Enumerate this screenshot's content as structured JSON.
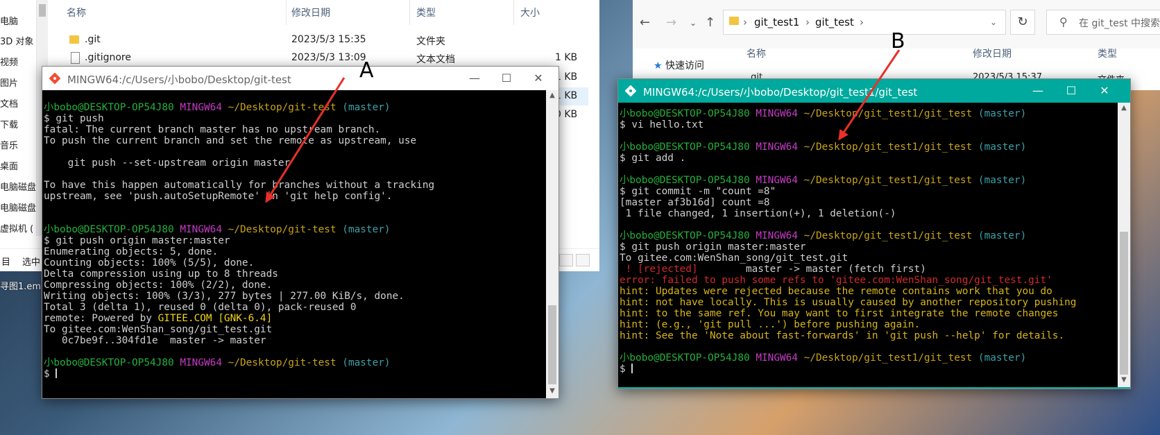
{
  "left_explorer": {
    "nav_items": [
      "电脑",
      "3D 对象",
      "视频",
      "图片",
      "文档",
      "下载",
      "音乐",
      "桌面",
      "电脑磁盘",
      "电脑磁盘",
      "虚拟机 ("
    ],
    "columns": {
      "name": "名称",
      "date": "修改日期",
      "type": "类型",
      "size": "大小"
    },
    "files": [
      {
        "name": ".git",
        "date": "2023/5/3 15:35",
        "type": "文件夹",
        "size": "",
        "icon": "folder-icon"
      },
      {
        "name": ".gitignore",
        "date": "2023/5/3 13:09",
        "type": "文本文档",
        "size": "1 KB",
        "icon": "document-icon"
      },
      {
        "name": "",
        "date": "",
        "type": "",
        "size": "1 KB",
        "icon": ""
      },
      {
        "name": "",
        "date": "",
        "type": "",
        "size": "1 KB",
        "icon": ""
      },
      {
        "name": "",
        "date": "",
        "type": "",
        "size": "0 KB",
        "icon": ""
      }
    ],
    "status_left": "目",
    "status_select": "选中",
    "truncated_file": "寻图1.em"
  },
  "right_explorer": {
    "breadcrumb": [
      "git_test1",
      "git_test"
    ],
    "search_placeholder": "在 git_test 中搜索",
    "quick_access": "快速访问",
    "columns": {
      "name": "名称",
      "date": "修改日期",
      "type": "类型"
    },
    "partial_row": {
      "name": ".git",
      "date": "2023/5/3 15:37",
      "type": "文件夹"
    }
  },
  "terminal_a": {
    "title": "MINGW64:/c/Users/小bobo/Desktop/git-test",
    "lines": [
      [
        [
          "小bobo@DESKTOP-OP54J80 ",
          "green"
        ],
        [
          "MINGW64 ",
          "purple"
        ],
        [
          "~/Desktop/git-test ",
          "yellow"
        ],
        [
          "(master)",
          "cyan"
        ]
      ],
      [
        [
          "$ git push",
          "white"
        ]
      ],
      [
        [
          "fatal: The current branch master has no upstream branch.",
          "white"
        ]
      ],
      [
        [
          "To push the current branch and set the remote as upstream, use",
          "white"
        ]
      ],
      [
        [
          "",
          "white"
        ]
      ],
      [
        [
          "    git push --set-upstream origin master",
          "white"
        ]
      ],
      [
        [
          "",
          "white"
        ]
      ],
      [
        [
          "To have this happen automatically for branches without a tracking",
          "white"
        ]
      ],
      [
        [
          "upstream, see 'push.autoSetupRemote' in 'git help config'.",
          "white"
        ]
      ],
      [
        [
          "",
          "white"
        ]
      ],
      [
        [
          "",
          "white"
        ]
      ],
      [
        [
          "小bobo@DESKTOP-OP54J80 ",
          "green"
        ],
        [
          "MINGW64 ",
          "purple"
        ],
        [
          "~/Desktop/git-test ",
          "yellow"
        ],
        [
          "(master)",
          "cyan"
        ]
      ],
      [
        [
          "$ git push origin master:master",
          "white"
        ]
      ],
      [
        [
          "Enumerating objects: 5, done.",
          "white"
        ]
      ],
      [
        [
          "Counting objects: 100% (5/5), done.",
          "white"
        ]
      ],
      [
        [
          "Delta compression using up to 8 threads",
          "white"
        ]
      ],
      [
        [
          "Compressing objects: 100% (2/2), done.",
          "white"
        ]
      ],
      [
        [
          "Writing objects: 100% (3/3), 277 bytes | 277.00 KiB/s, done.",
          "white"
        ]
      ],
      [
        [
          "Total 3 (delta 1), reused 0 (delta 0), pack-reused 0",
          "white"
        ]
      ],
      [
        [
          "remote: Powered by ",
          "white"
        ],
        [
          "GITEE.COM ",
          "gitee"
        ],
        [
          "[GNK-6.4]",
          "gitee"
        ]
      ],
      [
        [
          "To gitee.com:WenShan_song/git_test.git",
          "white"
        ]
      ],
      [
        [
          "   0c7be9f..304fd1e  master -> master",
          "white"
        ]
      ],
      [
        [
          "",
          "white"
        ]
      ],
      [
        [
          "小bobo@DESKTOP-OP54J80 ",
          "green"
        ],
        [
          "MINGW64 ",
          "purple"
        ],
        [
          "~/Desktop/git-test ",
          "yellow"
        ],
        [
          "(master)",
          "cyan"
        ]
      ],
      [
        [
          "$ ",
          "white"
        ]
      ]
    ]
  },
  "terminal_b": {
    "title": "MINGW64:/c/Users/小bobo/Desktop/git_test1/git_test",
    "lines": [
      [
        [
          "小bobo@DESKTOP-OP54J80 ",
          "green"
        ],
        [
          "MINGW64 ",
          "purple"
        ],
        [
          "~/Desktop/git_test1/git_test ",
          "yellow"
        ],
        [
          "(master)",
          "cyan"
        ]
      ],
      [
        [
          "$ vi hello.txt",
          "white"
        ]
      ],
      [
        [
          "",
          "white"
        ]
      ],
      [
        [
          "小bobo@DESKTOP-OP54J80 ",
          "green"
        ],
        [
          "MINGW64 ",
          "purple"
        ],
        [
          "~/Desktop/git_test1/git_test ",
          "yellow"
        ],
        [
          "(master)",
          "cyan"
        ]
      ],
      [
        [
          "$ git add .",
          "white"
        ]
      ],
      [
        [
          "",
          "white"
        ]
      ],
      [
        [
          "小bobo@DESKTOP-OP54J80 ",
          "green"
        ],
        [
          "MINGW64 ",
          "purple"
        ],
        [
          "~/Desktop/git_test1/git_test ",
          "yellow"
        ],
        [
          "(master)",
          "cyan"
        ]
      ],
      [
        [
          "$ git commit -m \"count =8\"",
          "white"
        ]
      ],
      [
        [
          "[master af3b16d] count =8",
          "white"
        ]
      ],
      [
        [
          " 1 file changed, 1 insertion(+), 1 deletion(-)",
          "white"
        ]
      ],
      [
        [
          "",
          "white"
        ]
      ],
      [
        [
          "小bobo@DESKTOP-OP54J80 ",
          "green"
        ],
        [
          "MINGW64 ",
          "purple"
        ],
        [
          "~/Desktop/git_test1/git_test ",
          "yellow"
        ],
        [
          "(master)",
          "cyan"
        ]
      ],
      [
        [
          "$ git push origin master:master",
          "white"
        ]
      ],
      [
        [
          "To gitee.com:WenShan_song/git_test.git",
          "white"
        ]
      ],
      [
        [
          " ! [rejected]        ",
          "red"
        ],
        [
          "master -> master (fetch first)",
          "white"
        ]
      ],
      [
        [
          "error: failed to push some refs to 'gitee.com:WenShan_song/git_test.git'",
          "red"
        ]
      ],
      [
        [
          "hint: Updates were rejected because the remote contains work that you do",
          "hint"
        ]
      ],
      [
        [
          "hint: not have locally. This is usually caused by another repository pushing",
          "hint"
        ]
      ],
      [
        [
          "hint: to the same ref. You may want to first integrate the remote changes",
          "hint"
        ]
      ],
      [
        [
          "hint: (e.g., 'git pull ...') before pushing again.",
          "hint"
        ]
      ],
      [
        [
          "hint: See the 'Note about fast-forwards' in 'git push --help' for details.",
          "hint"
        ]
      ],
      [
        [
          "",
          "white"
        ]
      ],
      [
        [
          "小bobo@DESKTOP-OP54J80 ",
          "green"
        ],
        [
          "MINGW64 ",
          "purple"
        ],
        [
          "~/Desktop/git_test1/git_test ",
          "yellow"
        ],
        [
          "(master)",
          "cyan"
        ]
      ],
      [
        [
          "$ ",
          "white"
        ]
      ]
    ]
  },
  "annotations": {
    "a": "A",
    "b": "B"
  },
  "colors": {
    "annotation_arrow": "#e8302a",
    "terminal_b_titlebar": "#00a99d"
  }
}
